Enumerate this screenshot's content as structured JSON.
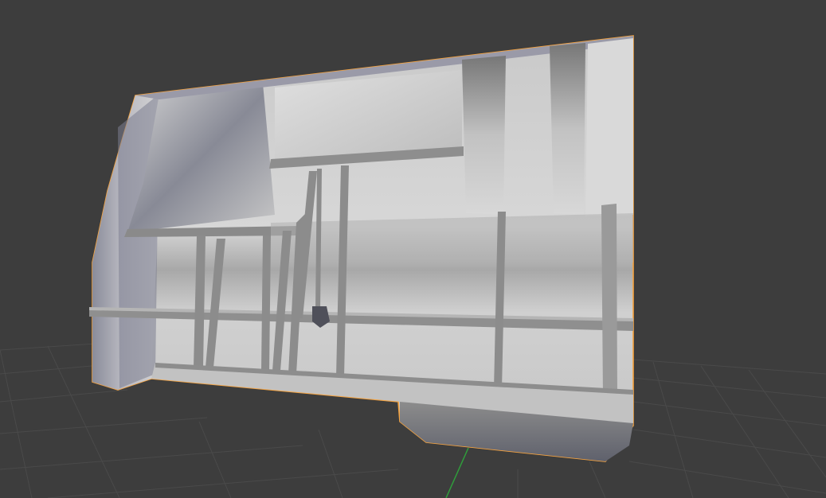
{
  "viewport": {
    "background": "#3d3d3d",
    "grid_line_color": "#4a4a4a",
    "y_axis_color": "#2f9e3b",
    "selection_outline_color": "#f5a340"
  },
  "object": {
    "selected": true,
    "material_colors": {
      "light": "#dcdcdc",
      "mid": "#b9b9b9",
      "shadow": "#6f7184",
      "dark": "#5a5b66",
      "spar": "#8a8a8a"
    }
  }
}
